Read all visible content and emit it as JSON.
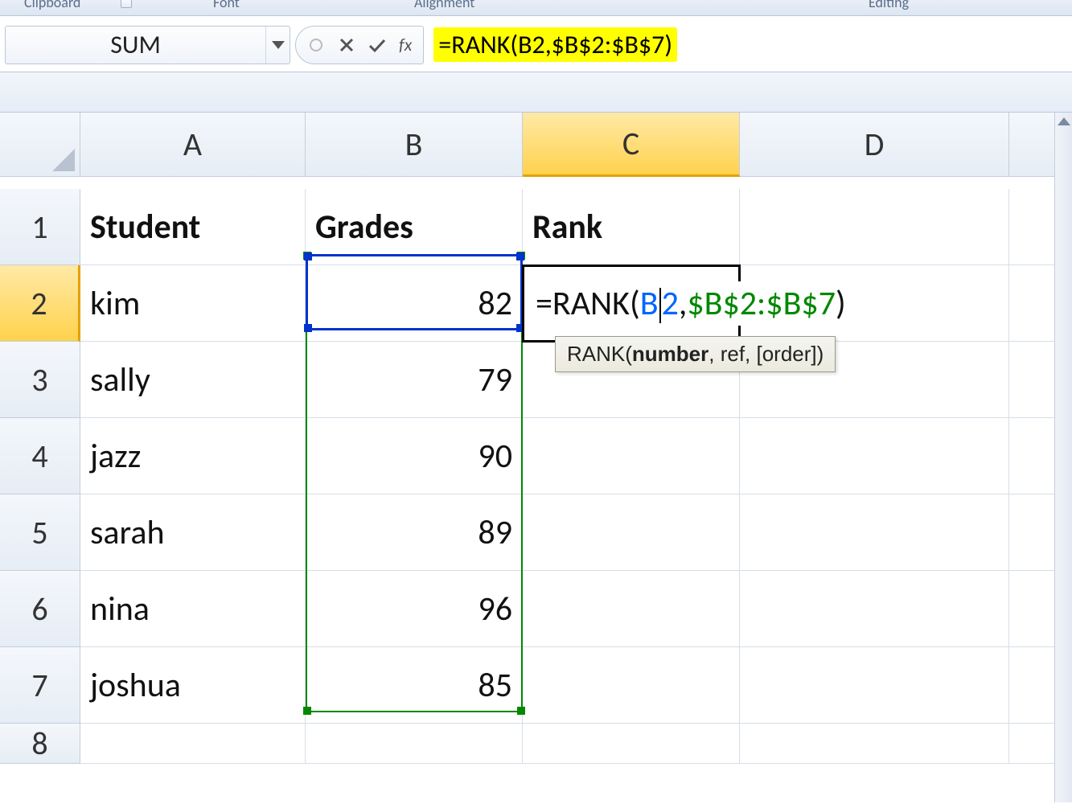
{
  "ribbon": {
    "groups": [
      "Clipboard",
      "Font",
      "Alignment",
      "Editing"
    ]
  },
  "namebox": {
    "value": "SUM"
  },
  "formula_bar": {
    "fx_label": "fx",
    "formula": "=RANK(B2,$B$2:$B$7)"
  },
  "columns": [
    "A",
    "B",
    "C",
    "D"
  ],
  "rows": [
    "1",
    "2",
    "3",
    "4",
    "5",
    "6",
    "7",
    "8"
  ],
  "headers": {
    "student": "Student",
    "grades": "Grades",
    "rank": "Rank"
  },
  "data": {
    "students": [
      "kim",
      "sally",
      "jazz",
      "sarah",
      "nina",
      "joshua"
    ],
    "grades": [
      "82",
      "79",
      "90",
      "89",
      "96",
      "85"
    ]
  },
  "editing_cell": {
    "parts": {
      "prefix": "=RANK(",
      "arg1_a": "B",
      "arg1_b": "2",
      "comma": ",",
      "arg2": "$B$2:$B$7",
      "suffix": ")"
    }
  },
  "tooltip": {
    "fn": "RANK(",
    "arg1": "number",
    "rest": ", ref, [order])"
  }
}
